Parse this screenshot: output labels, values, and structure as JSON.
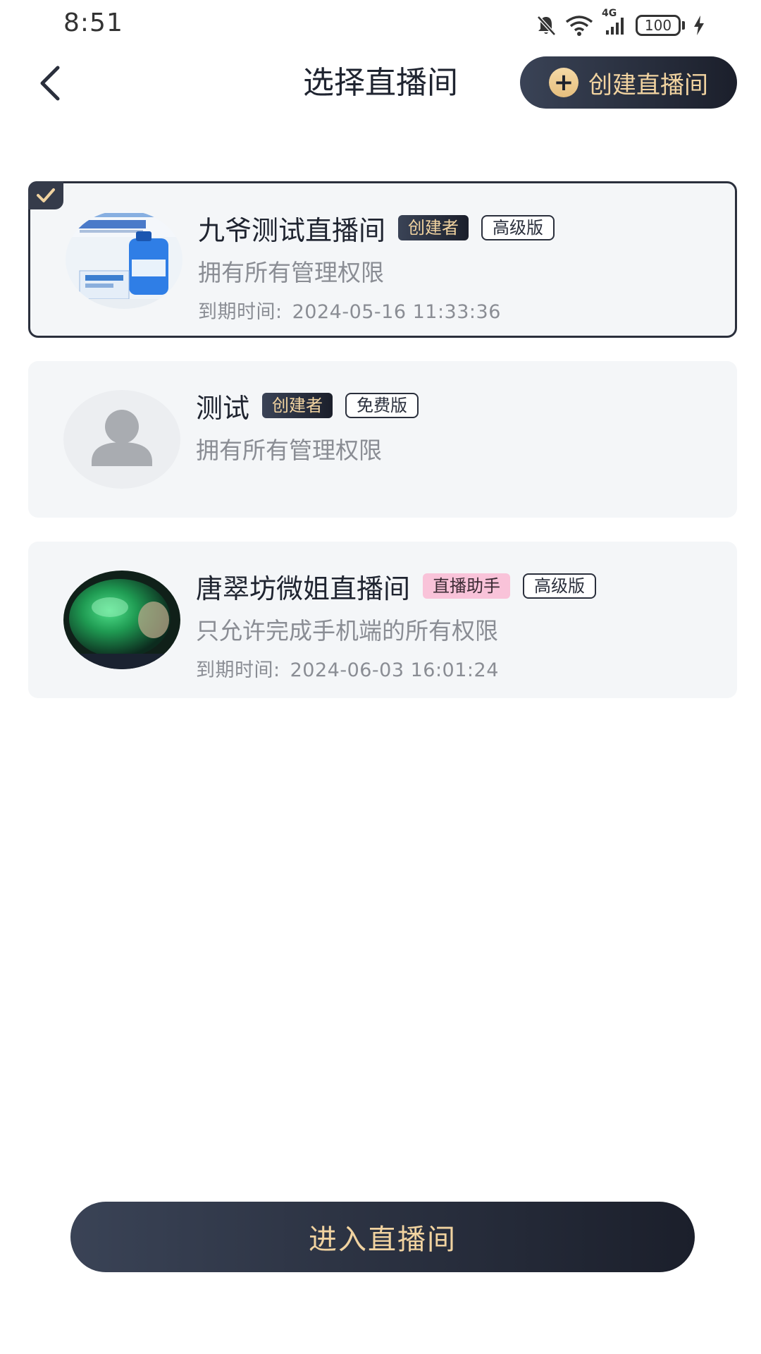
{
  "status_bar": {
    "time": "8:51",
    "network": "4G",
    "battery": "100",
    "icons": [
      "bell-off-icon",
      "wifi-icon",
      "signal-icon",
      "battery-icon",
      "charging-icon"
    ]
  },
  "header": {
    "title": "选择直播间",
    "create_button": "创建直播间",
    "back_icon": "chevron-left-icon"
  },
  "rooms": [
    {
      "name": "九爷测试直播间",
      "role": "创建者",
      "edition": "高级版",
      "permission": "拥有所有管理权限",
      "expire_label": "到期时间:",
      "expire_date": "2024-05-16 11:33:36",
      "selected": true
    },
    {
      "name": "测试",
      "role": "创建者",
      "edition": "免费版",
      "permission": "拥有所有管理权限",
      "selected": false
    },
    {
      "name": "唐翠坊微姐直播间",
      "role": "直播助手",
      "edition": "高级版",
      "permission": "只允许完成手机端的所有权限",
      "expire_label": "到期时间:",
      "expire_date": "2024-06-03 16:01:24",
      "selected": false
    }
  ],
  "footer": {
    "enter_button": "进入直播间"
  },
  "colors": {
    "accent_gold": "#f1d3a0",
    "dark_button": "#1b1f2b",
    "card_bg": "#f4f6f8",
    "assistant_tag": "#f9c3d9"
  }
}
